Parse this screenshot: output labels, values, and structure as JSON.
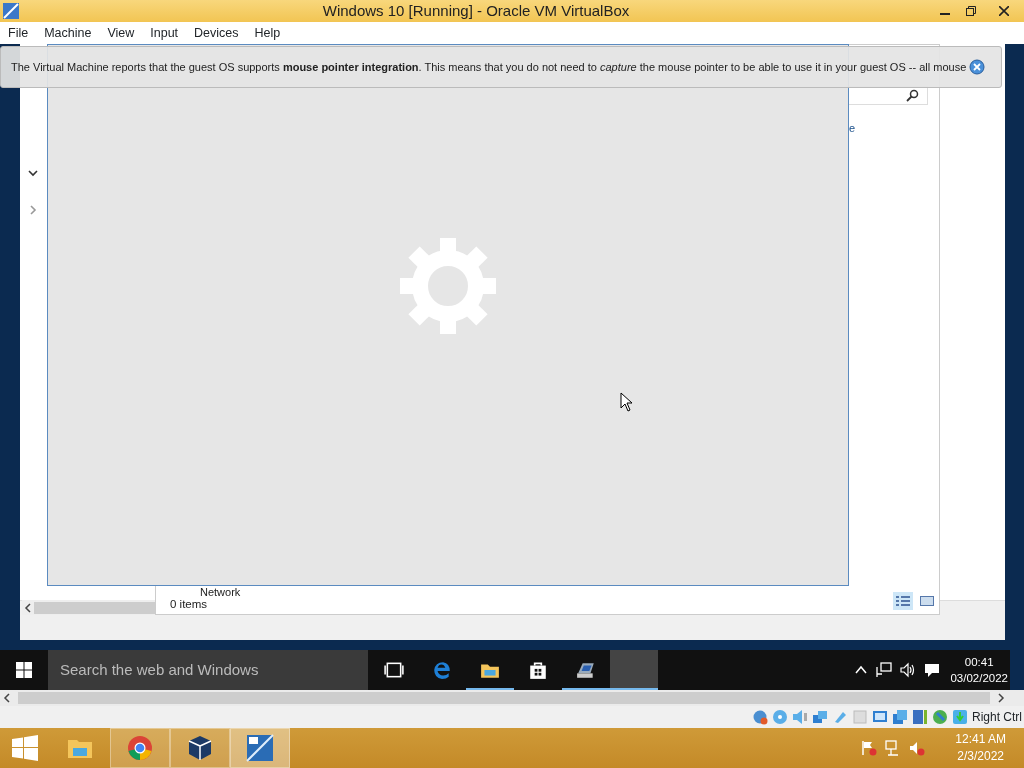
{
  "window": {
    "title": "Windows 10 [Running] - Oracle VM VirtualBox"
  },
  "menu": [
    "File",
    "Machine",
    "View",
    "Input",
    "Devices",
    "Help"
  ],
  "notification": {
    "text": "The Virtual Machine reports that the guest OS supports **mouse pointer integration**. This means that you do not need to *capture* the mouse pointer to be able to use it in your guest OS -- all mouse"
  },
  "guest": {
    "explorer": {
      "cut_text": "e",
      "nav_nodes": [
        {
          "expanded": true
        },
        {
          "expanded": false
        }
      ],
      "network_label": "Network",
      "status": "0 items",
      "views": [
        {
          "selected": true
        },
        {
          "selected": false
        }
      ]
    },
    "taskbar": {
      "search_placeholder": "Search the web and Windows",
      "apps": [
        {
          "kind": "taskview",
          "running": false,
          "selected": false
        },
        {
          "kind": "edge",
          "running": false,
          "selected": false
        },
        {
          "kind": "explorer",
          "running": true,
          "selected": false
        },
        {
          "kind": "store",
          "running": false,
          "selected": false
        },
        {
          "kind": "app",
          "running": true,
          "selected": false
        },
        {
          "kind": "blank",
          "running": true,
          "selected": true
        }
      ],
      "clock": {
        "time": "00:41",
        "date": "03/02/2022"
      }
    }
  },
  "status_bar": {
    "host_key": "Right Ctrl"
  },
  "host_taskbar": {
    "apps": [
      {
        "kind": "explorer",
        "running": false,
        "selected": false
      },
      {
        "kind": "chrome",
        "running": true,
        "selected": false
      },
      {
        "kind": "virtualbox",
        "running": true,
        "selected": false
      },
      {
        "kind": "win10",
        "running": true,
        "selected": true
      }
    ],
    "clock": {
      "time": "12:41 AM",
      "date": "2/3/2022"
    }
  }
}
